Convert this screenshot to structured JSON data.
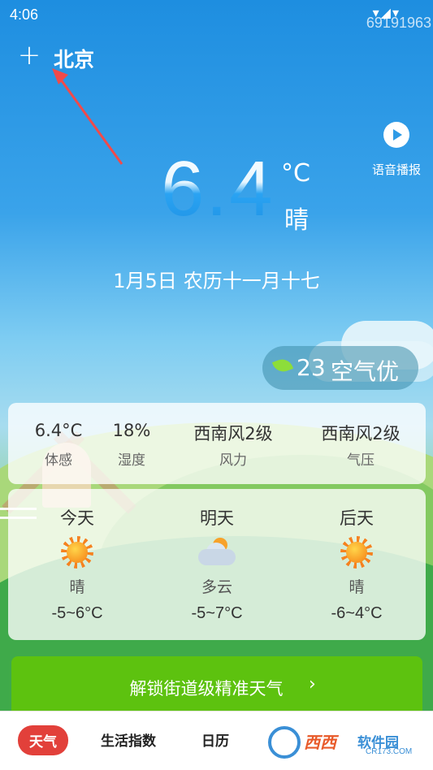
{
  "status_bar": {
    "time": "4:06",
    "icons": "▾◢▾",
    "watermark": "69191963"
  },
  "header": {
    "add_icon": "plus-icon",
    "city": "北京"
  },
  "voice": {
    "label": "语音播报",
    "icon": "play-icon"
  },
  "current": {
    "temperature": "6.4",
    "unit": "°C",
    "condition": "晴",
    "date": "1月5日",
    "lunar": "农历十一月十七"
  },
  "aqi": {
    "value": "23",
    "text": "空气优",
    "icon": "leaf-icon"
  },
  "details": [
    {
      "value": "6.4°C",
      "label": "体感"
    },
    {
      "value": "18%",
      "label": "湿度"
    },
    {
      "value": "西南风2级",
      "label": "风力"
    },
    {
      "value": "西南风2级",
      "label": "气压"
    }
  ],
  "forecast": [
    {
      "day": "今天",
      "icon": "sunny-icon",
      "condition": "晴",
      "temp": "-5~6°C"
    },
    {
      "day": "明天",
      "icon": "partly-cloudy-icon",
      "condition": "多云",
      "temp": "-5~7°C"
    },
    {
      "day": "后天",
      "icon": "sunny-icon",
      "condition": "晴",
      "temp": "-6~4°C"
    }
  ],
  "unlock": {
    "label": "解锁街道级精准天气",
    "chevron": "›"
  },
  "nav": {
    "items": [
      "天气",
      "生活指数",
      "日历"
    ],
    "watermark_brand": "西西",
    "watermark_sub": "软件园",
    "watermark_url": "CR173.COM"
  },
  "colors": {
    "accent": "#e2403a",
    "banner": "#5dc20f",
    "sky": "#1e8ee0"
  }
}
